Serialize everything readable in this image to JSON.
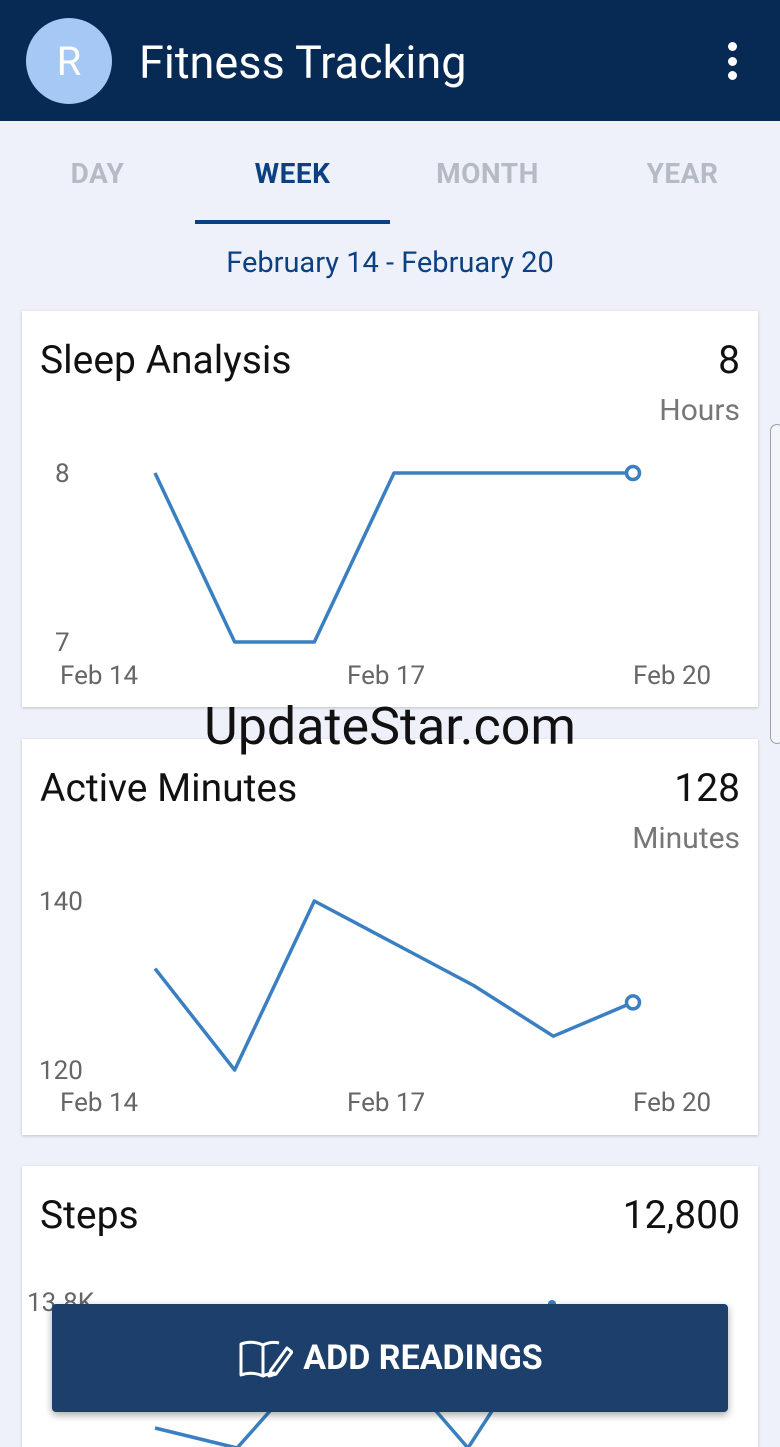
{
  "app": {
    "avatar_initial": "R",
    "title": "Fitness Tracking",
    "menu_icon": "more-vert-icon"
  },
  "tabs": [
    "DAY",
    "WEEK",
    "MONTH",
    "YEAR"
  ],
  "active_tab": "WEEK",
  "date_range": "February 14 - February 20",
  "cards": {
    "sleep": {
      "title": "Sleep Analysis",
      "value": "8",
      "unit": "Hours"
    },
    "active": {
      "title": "Active Minutes",
      "value": "128",
      "unit": "Minutes"
    },
    "steps": {
      "title": "Steps",
      "value": "12,800"
    }
  },
  "watermark": "UpdateStar.com",
  "fab": {
    "label": "ADD READINGS",
    "icon": "book-pencil-icon"
  },
  "colors": {
    "appbar": "#072a55",
    "accent": "#0b4183",
    "line": "#3a7fc1",
    "fab": "#1c3f6b"
  },
  "chart_data": [
    {
      "type": "line",
      "title": "Sleep Analysis",
      "x": [
        "Feb 14",
        "Feb 15",
        "Feb 16",
        "Feb 17",
        "Feb 18",
        "Feb 19",
        "Feb 20"
      ],
      "x_tick_labels": [
        "Feb 14",
        "Feb 17",
        "Feb 20"
      ],
      "y_tick_labels": [
        "8",
        "7"
      ],
      "series": [
        {
          "values": [
            8,
            7,
            7,
            8,
            8,
            8,
            8
          ]
        }
      ],
      "ylim": [
        7,
        8
      ],
      "grid": false
    },
    {
      "type": "line",
      "title": "Active Minutes",
      "x": [
        "Feb 14",
        "Feb 15",
        "Feb 16",
        "Feb 17",
        "Feb 18",
        "Feb 19",
        "Feb 20"
      ],
      "x_tick_labels": [
        "Feb 14",
        "Feb 17",
        "Feb 20"
      ],
      "y_tick_labels": [
        "140",
        "120"
      ],
      "series": [
        {
          "values": [
            132,
            120,
            140,
            135,
            130,
            124,
            128
          ]
        }
      ],
      "ylim": [
        120,
        140
      ],
      "grid": false
    },
    {
      "type": "line",
      "title": "Steps",
      "y_tick_labels": [
        "13.8K"
      ],
      "series": [
        {
          "values": []
        }
      ],
      "grid": false
    }
  ]
}
